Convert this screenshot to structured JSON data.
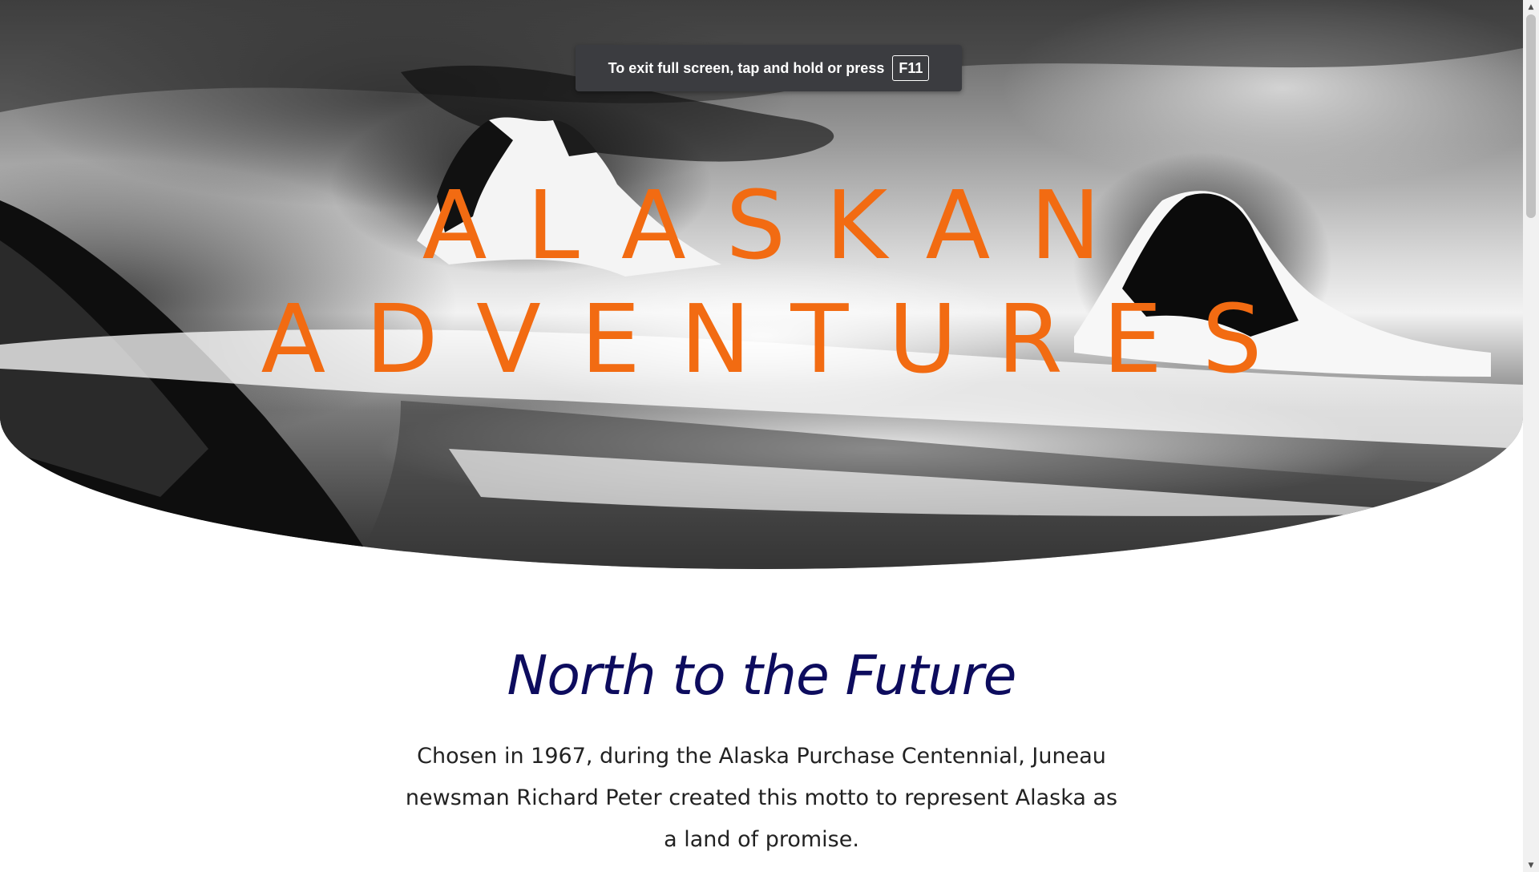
{
  "fullscreen_toast": {
    "message": "To exit full screen, tap and hold or press",
    "key": "F11"
  },
  "hero": {
    "title_line1": "ALASKAN",
    "title_line2": "ADVENTURES",
    "title_color": "#f26b12"
  },
  "section": {
    "heading": "North to the Future",
    "heading_color": "#0d0c5e",
    "body": "Chosen in 1967, during the Alaska Purchase Centennial, Juneau newsman Richard Peter created this motto to represent Alaska as a land of promise."
  },
  "scrollbar": {
    "up_icon": "scroll-up-arrow-icon",
    "down_icon": "scroll-down-arrow-icon"
  }
}
